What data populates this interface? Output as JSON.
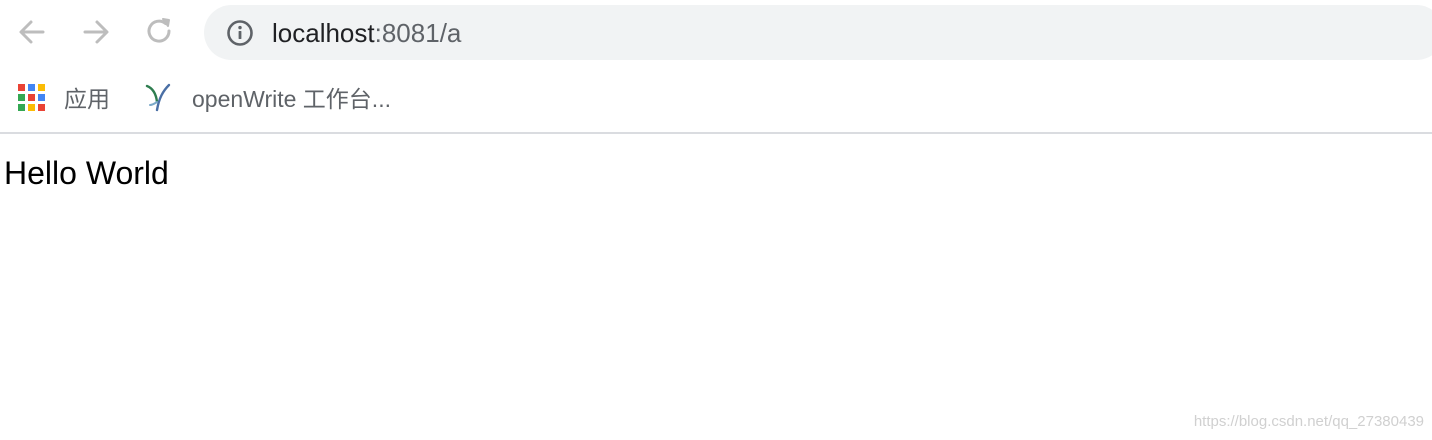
{
  "toolbar": {
    "back_icon": "arrow-left-icon",
    "forward_icon": "arrow-right-icon",
    "reload_icon": "reload-icon",
    "site_info_icon": "info-circle-icon",
    "url_host": "localhost",
    "url_rest": ":8081/a"
  },
  "bookmarks": {
    "items": [
      {
        "label": "应用",
        "icon": "apps-grid-icon"
      },
      {
        "label": "openWrite 工作台...",
        "icon": "openwrite-leaf-icon"
      }
    ],
    "apps_colors": [
      "#ea4335",
      "#4285f4",
      "#fbbc05",
      "#34a853",
      "#ea4335",
      "#4285f4",
      "#34a853",
      "#fbbc05",
      "#ea4335"
    ]
  },
  "page": {
    "body_text": "Hello World"
  },
  "watermark": "https://blog.csdn.net/qq_27380439"
}
